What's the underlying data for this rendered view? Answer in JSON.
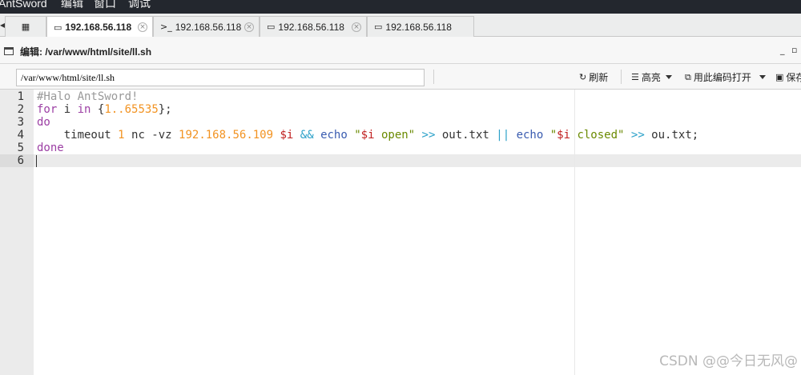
{
  "menubar": {
    "items": [
      "AntSword",
      "编辑",
      "窗口",
      "调试"
    ]
  },
  "tabs": [
    {
      "label": "192.168.56.118",
      "icon": "folder-icon",
      "active": true
    },
    {
      "label": "192.168.56.118",
      "icon": "terminal-icon",
      "active": false
    },
    {
      "label": "192.168.56.118",
      "icon": "folder-icon",
      "active": false
    },
    {
      "label": "192.168.56.118",
      "icon": "folder-icon",
      "active": false
    }
  ],
  "panel": {
    "title": "编辑: /var/www/html/site/ll.sh"
  },
  "toolbar": {
    "path_value": "/var/www/html/site/ll.sh",
    "refresh_label": "刷新",
    "highlight_label": "高亮",
    "encoding_label": "用此编码打开",
    "save_label": "保存"
  },
  "editor": {
    "line_numbers": [
      "1",
      "2",
      "3",
      "4",
      "5",
      "6"
    ],
    "current_line": 6,
    "lines": [
      [
        {
          "t": "#Halo AntSword!",
          "c": "comment"
        }
      ],
      [
        {
          "t": "for",
          "c": "kw"
        },
        {
          "t": " i ",
          "c": "plain"
        },
        {
          "t": "in",
          "c": "kw"
        },
        {
          "t": " {",
          "c": "plain"
        },
        {
          "t": "1..65535",
          "c": "num"
        },
        {
          "t": "};",
          "c": "plain"
        }
      ],
      [
        {
          "t": "do",
          "c": "kw"
        }
      ],
      [
        {
          "t": "    timeout ",
          "c": "plain"
        },
        {
          "t": "1",
          "c": "num"
        },
        {
          "t": " nc -vz ",
          "c": "plain"
        },
        {
          "t": "192.168.56.109",
          "c": "num"
        },
        {
          "t": " ",
          "c": "plain"
        },
        {
          "t": "$i",
          "c": "var"
        },
        {
          "t": " ",
          "c": "plain"
        },
        {
          "t": "&&",
          "c": "op"
        },
        {
          "t": " ",
          "c": "plain"
        },
        {
          "t": "echo",
          "c": "echo"
        },
        {
          "t": " ",
          "c": "plain"
        },
        {
          "t": "\"",
          "c": "str"
        },
        {
          "t": "$i",
          "c": "var"
        },
        {
          "t": " open\"",
          "c": "str"
        },
        {
          "t": " ",
          "c": "plain"
        },
        {
          "t": ">>",
          "c": "op"
        },
        {
          "t": " out.txt ",
          "c": "plain"
        },
        {
          "t": "||",
          "c": "op"
        },
        {
          "t": " ",
          "c": "plain"
        },
        {
          "t": "echo",
          "c": "echo"
        },
        {
          "t": " ",
          "c": "plain"
        },
        {
          "t": "\"",
          "c": "str"
        },
        {
          "t": "$i",
          "c": "var"
        },
        {
          "t": " closed\"",
          "c": "str"
        },
        {
          "t": " ",
          "c": "plain"
        },
        {
          "t": ">>",
          "c": "op"
        },
        {
          "t": " ou.txt;",
          "c": "plain"
        }
      ],
      [
        {
          "t": "done",
          "c": "kw"
        }
      ],
      []
    ]
  },
  "watermark": "CSDN @@今日无风@"
}
